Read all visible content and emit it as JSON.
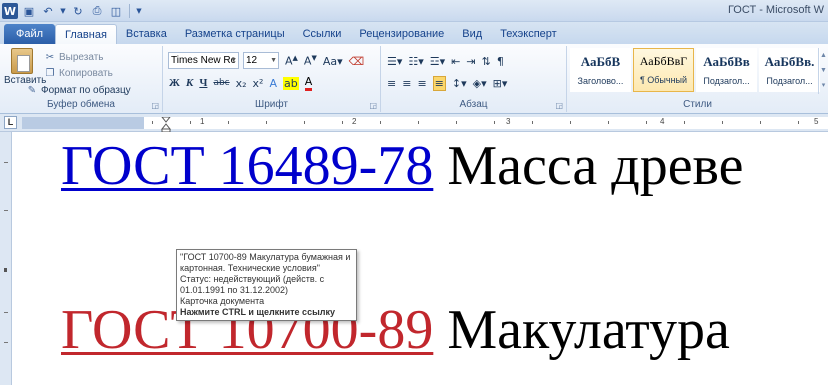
{
  "window": {
    "title": "ГОСТ - Microsoft W"
  },
  "tabs": [
    {
      "label": "Файл"
    },
    {
      "label": "Главная"
    },
    {
      "label": "Вставка"
    },
    {
      "label": "Разметка страницы"
    },
    {
      "label": "Ссылки"
    },
    {
      "label": "Рецензирование"
    },
    {
      "label": "Вид"
    },
    {
      "label": "Техэксперт"
    }
  ],
  "ribbon": {
    "clipboard": {
      "paste": "Вставить",
      "cut": "Вырезать",
      "copy": "Копировать",
      "format_painter": "Формат по образцу",
      "label": "Буфер обмена"
    },
    "font": {
      "family": "Times New Rc",
      "size": "12",
      "label": "Шрифт"
    },
    "paragraph": {
      "label": "Абзац"
    },
    "styles": {
      "label": "Стили",
      "items": [
        {
          "preview": "АаБбВ",
          "name": "Заголово..."
        },
        {
          "preview": "АаБбВвГ",
          "name": "¶ Обычный"
        },
        {
          "preview": "АаБбВв",
          "name": "Подзагол..."
        },
        {
          "preview": "АаБбВв.",
          "name": "Подзагол..."
        }
      ]
    }
  },
  "ruler": {
    "numbers": [
      "1",
      "2",
      "3",
      "4",
      "5"
    ],
    "corner": "L"
  },
  "document": {
    "line1": {
      "link": "ГОСТ 16489-78",
      "text": " Масса древе"
    },
    "line2": {
      "link": "ГОСТ 10700-89",
      "text": " Макулатура"
    }
  },
  "tooltip": {
    "lines": [
      "\"ГОСТ 10700-89 Макулатура бумажная и картонная. Технические условия\"",
      "Статус: недействующий  (действ. с 01.01.1991 по 31.12.2002)",
      "Карточка документа",
      "Нажмите CTRL и щелкните ссылку"
    ]
  },
  "colors": {
    "link_visited": "#0000cc",
    "link_hover": "#c1272d",
    "file_tab": "#2b5ea8"
  }
}
